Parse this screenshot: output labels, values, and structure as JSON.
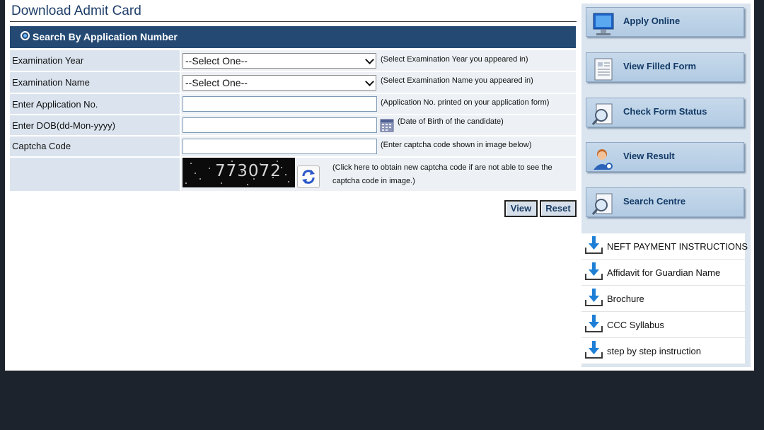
{
  "page": {
    "title": "Download Admit Card",
    "section_label": "Search By Application Number"
  },
  "form": {
    "exam_year": {
      "label": "Examination Year",
      "value": "--Select One--",
      "hint": "(Select Examination Year you appeared in)"
    },
    "exam_name": {
      "label": "Examination Name",
      "value": "--Select One--",
      "hint": "(Select Examination Name you appeared in)"
    },
    "app_no": {
      "label": "Enter Application No.",
      "value": "",
      "hint": "(Application No. printed on your application form)"
    },
    "dob": {
      "label": "Enter DOB(dd-Mon-yyyy)",
      "value": "",
      "hint": "(Date of Birth of the candidate)"
    },
    "captcha": {
      "label": "Captcha Code",
      "value": "",
      "hint": "(Enter captcha code shown in image below)"
    },
    "captcha_image_text": "773072",
    "captcha_refresh_hint_line1": "(Click here to obtain new captcha code if are not able to see the",
    "captcha_refresh_hint_line2": "captcha code in image.)"
  },
  "actions": {
    "view": "View",
    "reset": "Reset"
  },
  "sidebar": {
    "buttons": [
      {
        "label": "Apply Online",
        "icon": "monitor-icon"
      },
      {
        "label": "View Filled Form",
        "icon": "form-icon"
      },
      {
        "label": "Check Form Status",
        "icon": "magnifier-icon"
      },
      {
        "label": "View Result",
        "icon": "user-icon"
      },
      {
        "label": "Search Centre",
        "icon": "magnifier-icon"
      }
    ],
    "downloads": [
      {
        "label": "NEFT PAYMENT INSTRUCTIONS",
        "icon": "download-arrow-icon"
      },
      {
        "label": "Affidavit for Guardian Name",
        "icon": "download-arrow-icon"
      },
      {
        "label": "Brochure",
        "icon": "download-arrow-icon"
      },
      {
        "label": "CCC Syllabus",
        "icon": "download-arrow-icon"
      },
      {
        "label": "step by step instruction",
        "icon": "download-arrow-icon"
      }
    ]
  },
  "colors": {
    "header_bar": "#244a74",
    "label_bg": "#dbe4ee",
    "page_bg": "#1c232d"
  }
}
